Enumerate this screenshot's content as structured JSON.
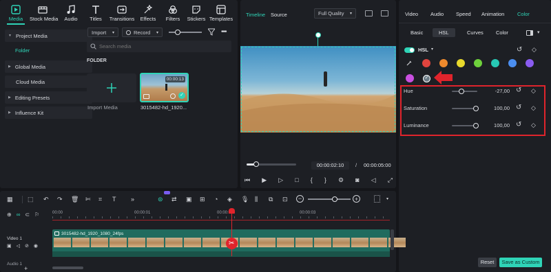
{
  "toolbar": {
    "items": [
      {
        "label": "Media",
        "icon": "media-icon"
      },
      {
        "label": "Stock Media",
        "icon": "stock-media-icon"
      },
      {
        "label": "Audio",
        "icon": "audio-icon"
      },
      {
        "label": "Titles",
        "icon": "titles-icon"
      },
      {
        "label": "Transitions",
        "icon": "transitions-icon"
      },
      {
        "label": "Effects",
        "icon": "effects-icon"
      },
      {
        "label": "Filters",
        "icon": "filters-icon"
      },
      {
        "label": "Stickers",
        "icon": "stickers-icon"
      },
      {
        "label": "Templates",
        "icon": "templates-icon"
      }
    ]
  },
  "sidebar": {
    "items": [
      {
        "label": "Project Media",
        "expand": "▼"
      },
      {
        "label": "Folder"
      },
      {
        "label": "Global Media",
        "expand": "▶"
      },
      {
        "label": "Cloud Media"
      },
      {
        "label": "Editing Presets",
        "expand": "▶"
      },
      {
        "label": "Influence Kit",
        "expand": "▶"
      }
    ]
  },
  "media": {
    "import_label": "Import",
    "record_label": "Record",
    "search_placeholder": "Search media",
    "folder_heading": "FOLDER",
    "import_media_label": "Import Media",
    "clip": {
      "duration": "00:00:13",
      "name": "3015482-hd_1920..."
    }
  },
  "player": {
    "tab_timeline": "Timeline",
    "tab_source": "Source",
    "quality": "Full Quality",
    "current_time": "00:00:02:10",
    "separator": "/",
    "total_time": "00:00:05:00",
    "progress": 0.2
  },
  "properties": {
    "tabs": [
      "Video",
      "Audio",
      "Speed",
      "Animation",
      "Color"
    ],
    "active_tab": "Color",
    "subtabs": [
      "Basic",
      "HSL",
      "Curves",
      "Color"
    ],
    "active_subtab": "HSL",
    "hsl_label": "HSL",
    "swatches": [
      "#e0443e",
      "#ee8a2d",
      "#e8d92c",
      "#6fd13c",
      "#27c8b4",
      "#4b8ef0",
      "#8a5cf0",
      "#c94fe0",
      "#c94fe0",
      "#1fbf9a"
    ],
    "rows": [
      {
        "label": "Hue",
        "value": "-27,00",
        "level": 0.35
      },
      {
        "label": "Saturation",
        "value": "100,00",
        "level": 1
      },
      {
        "label": "Luminance",
        "value": "100,00",
        "level": 1
      }
    ],
    "reset_label": "Reset",
    "save_label": "Save as Custom",
    "accent": "#2fd4b7",
    "highlight": "#e0242c"
  },
  "timeline": {
    "ruler": [
      "00:00",
      "00:00:01",
      "00:00:02",
      "00:00:03"
    ],
    "video_track_label": "Video 1",
    "audio_track_label": "Audio 1",
    "clip_name": "3015482-hd_1920_1080_24fps",
    "playhead_fraction": 0.53
  }
}
